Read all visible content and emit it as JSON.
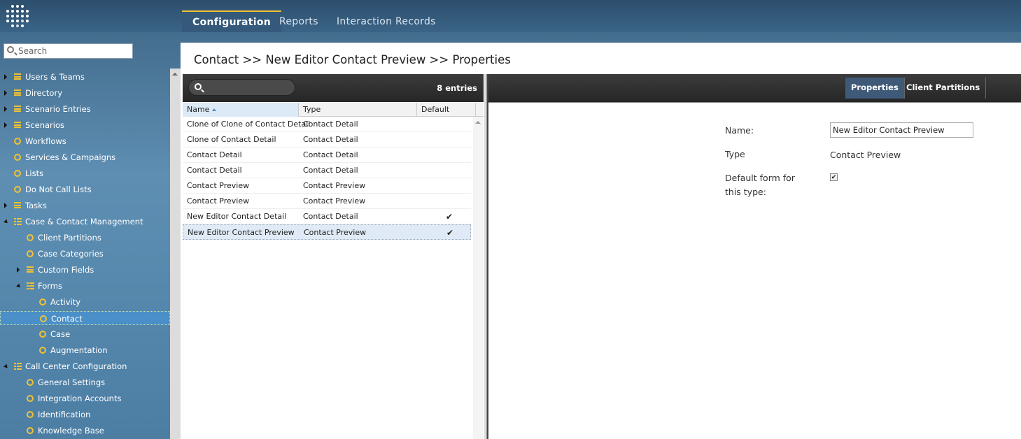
{
  "topnav": {
    "tabs": [
      {
        "label": "Configuration",
        "active": true
      },
      {
        "label": "Reports",
        "active": false
      },
      {
        "label": "Interaction Records",
        "active": false
      }
    ]
  },
  "sidebar": {
    "search_placeholder": "Search",
    "items": [
      {
        "label": "Users & Teams",
        "icon": "list-icon",
        "expander": "collapsed"
      },
      {
        "label": "Directory",
        "icon": "list-icon",
        "expander": "collapsed"
      },
      {
        "label": "Scenario Entries",
        "icon": "list-icon",
        "expander": "collapsed"
      },
      {
        "label": "Scenarios",
        "icon": "list-icon",
        "expander": "collapsed"
      },
      {
        "label": "Workflows",
        "icon": "circle-icon"
      },
      {
        "label": "Services & Campaigns",
        "icon": "circle-icon"
      },
      {
        "label": "Lists",
        "icon": "circle-icon"
      },
      {
        "label": "Do Not Call Lists",
        "icon": "circle-icon"
      },
      {
        "label": "Tasks",
        "icon": "list-icon",
        "expander": "collapsed"
      },
      {
        "label": "Case & Contact Management",
        "icon": "open-list-icon",
        "expander": "expanded"
      },
      {
        "label": "Client Partitions",
        "icon": "circle-icon"
      },
      {
        "label": "Case Categories",
        "icon": "circle-icon"
      },
      {
        "label": "Custom Fields",
        "icon": "list-icon",
        "expander": "collapsed"
      },
      {
        "label": "Forms",
        "icon": "open-list-icon",
        "expander": "expanded"
      },
      {
        "label": "Activity",
        "icon": "circle-icon"
      },
      {
        "label": "Contact",
        "icon": "circle-icon",
        "selected": true
      },
      {
        "label": "Case",
        "icon": "circle-icon"
      },
      {
        "label": "Augmentation",
        "icon": "circle-icon"
      },
      {
        "label": "Call Center Configuration",
        "icon": "open-list-icon",
        "expander": "expanded"
      },
      {
        "label": "General Settings",
        "icon": "circle-icon"
      },
      {
        "label": "Integration Accounts",
        "icon": "circle-icon"
      },
      {
        "label": "Identification",
        "icon": "circle-icon"
      },
      {
        "label": "Knowledge Base",
        "icon": "circle-icon"
      }
    ]
  },
  "breadcrumb": "Contact >> New Editor Contact Preview >> Properties",
  "grid": {
    "entries_label": "8 entries",
    "columns": [
      "Name",
      "Type",
      "Default"
    ],
    "rows": [
      {
        "name": "Clone of Clone of Contact Detail",
        "type": "Contact Detail",
        "default": ""
      },
      {
        "name": "Clone of Contact Detail",
        "type": "Contact Detail",
        "default": ""
      },
      {
        "name": "Contact Detail",
        "type": "Contact Detail",
        "default": ""
      },
      {
        "name": "Contact Detail",
        "type": "Contact Detail",
        "default": ""
      },
      {
        "name": "Contact Preview",
        "type": "Contact Preview",
        "default": ""
      },
      {
        "name": "Contact Preview",
        "type": "Contact Preview",
        "default": ""
      },
      {
        "name": "New Editor Contact Detail",
        "type": "Contact Detail",
        "default": "✔"
      },
      {
        "name": "New Editor Contact Preview",
        "type": "Contact Preview",
        "default": "✔"
      }
    ]
  },
  "properties": {
    "tabs": [
      "Properties",
      "Client Partitions"
    ],
    "name_label": "Name:",
    "name_value": "New Editor Contact Preview",
    "type_label": "Type",
    "type_value": "Contact Preview",
    "default_label": "Default form for this type:",
    "default_checked": "✔"
  },
  "colors": {
    "accent": "#f1c232",
    "selection": "#4a8fc7"
  }
}
